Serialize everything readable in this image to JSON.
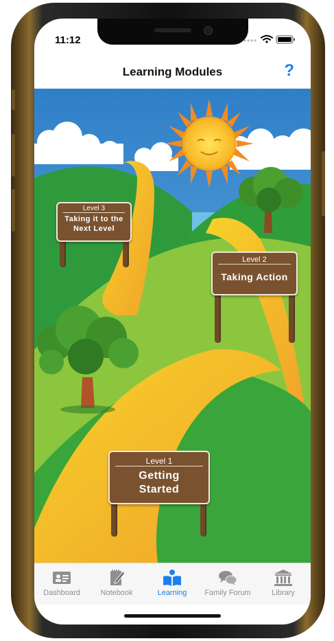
{
  "status": {
    "time": "11:12"
  },
  "nav": {
    "title": "Learning Modules",
    "help_label": "?"
  },
  "signs": [
    {
      "level": "Level 3",
      "title": "Taking it to the Next Level"
    },
    {
      "level": "Level 2",
      "title": "Taking Action"
    },
    {
      "level": "Level 1",
      "title": "Getting Started"
    }
  ],
  "tabs": [
    {
      "label": "Dashboard",
      "icon": "id-card-icon",
      "active": false
    },
    {
      "label": "Notebook",
      "icon": "notebook-pencil-icon",
      "active": false
    },
    {
      "label": "Learning",
      "icon": "reader-book-icon",
      "active": true
    },
    {
      "label": "Family Forum",
      "icon": "chat-bubbles-icon",
      "active": false
    },
    {
      "label": "Library",
      "icon": "library-building-icon",
      "active": false
    }
  ],
  "colors": {
    "accent": "#1a7ff0",
    "inactive": "#8e8e93",
    "sign": "#7a5230",
    "sky": "#3b8fd0",
    "grass": "#3aa53a"
  }
}
